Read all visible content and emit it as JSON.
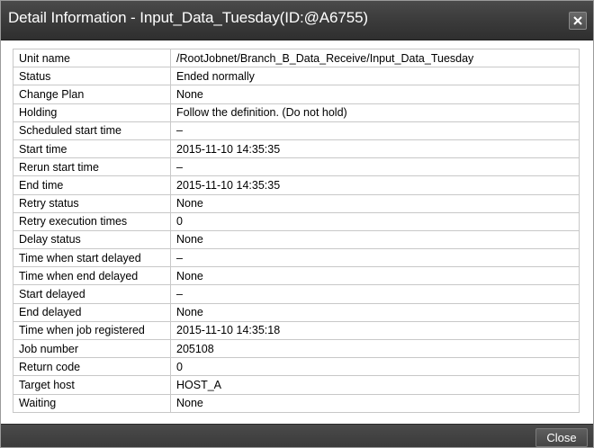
{
  "window": {
    "title": "Detail Information - Input_Data_Tuesday(ID:@A6755)",
    "close_icon": "close-icon"
  },
  "details": [
    {
      "label": "Unit name",
      "value": "/RootJobnet/Branch_B_Data_Receive/Input_Data_Tuesday"
    },
    {
      "label": "Status",
      "value": "Ended normally"
    },
    {
      "label": "Change Plan",
      "value": "None"
    },
    {
      "label": "Holding",
      "value": "Follow the definition. (Do not hold)"
    },
    {
      "label": "Scheduled start time",
      "value": "–"
    },
    {
      "label": "Start time",
      "value": "2015-11-10 14:35:35"
    },
    {
      "label": "Rerun start time",
      "value": "–"
    },
    {
      "label": "End time",
      "value": "2015-11-10 14:35:35"
    },
    {
      "label": "Retry status",
      "value": "None"
    },
    {
      "label": "Retry execution times",
      "value": "0"
    },
    {
      "label": "Delay status",
      "value": "None"
    },
    {
      "label": "Time when start delayed",
      "value": "–"
    },
    {
      "label": "Time when end delayed",
      "value": "None"
    },
    {
      "label": "Start delayed",
      "value": "–"
    },
    {
      "label": "End delayed",
      "value": "None"
    },
    {
      "label": "Time when job registered",
      "value": "2015-11-10 14:35:18"
    },
    {
      "label": "Job number",
      "value": "205108"
    },
    {
      "label": "Return code",
      "value": "0"
    },
    {
      "label": "Target host",
      "value": "HOST_A"
    },
    {
      "label": "Waiting",
      "value": "None"
    }
  ],
  "footer": {
    "close_label": "Close"
  },
  "colors": {
    "titlebar": "#3b3b3b",
    "footer": "#3a3a3a",
    "border": "#c8c8c8"
  }
}
